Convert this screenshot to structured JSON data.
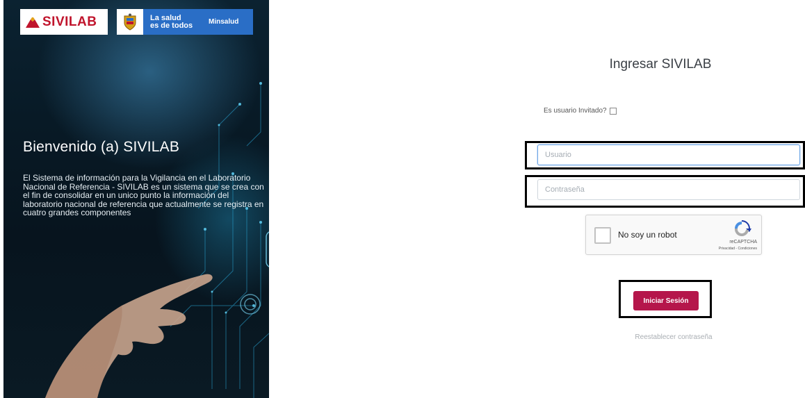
{
  "hero": {
    "logo_text": "SIVILAB",
    "slogan_line1": "La salud",
    "slogan_line2": "es de todos",
    "ministry": "Minsalud",
    "welcome_title": "Bienvenido (a) SIVILAB",
    "description": "El Sistema de información para la Vigilancia en el Laboratorio Nacional de Referencia - SIVILAB es un sistema que se crea con el fin de consolidar en un unico punto la información del laboratorio nacional de referencia que actualmente se registra en cuatro grandes componentes"
  },
  "login": {
    "title": "Ingresar SIVILAB",
    "guest_label": "Es usuario Invitado?",
    "guest_checked": false,
    "username_placeholder": "Usuario",
    "password_placeholder": "Contraseña",
    "submit_label": "Iniciar Sesión",
    "reset_link": "Reestablecer contraseña"
  },
  "recaptcha": {
    "label": "No soy un robot",
    "brand": "reCAPTCHA",
    "terms": "Privacidad - Condiciones"
  },
  "colors": {
    "primary_button": "#b5164b",
    "logo_red": "#c0142c",
    "gov_blue": "#2a6ec6",
    "hero_bg": "#081a26"
  }
}
